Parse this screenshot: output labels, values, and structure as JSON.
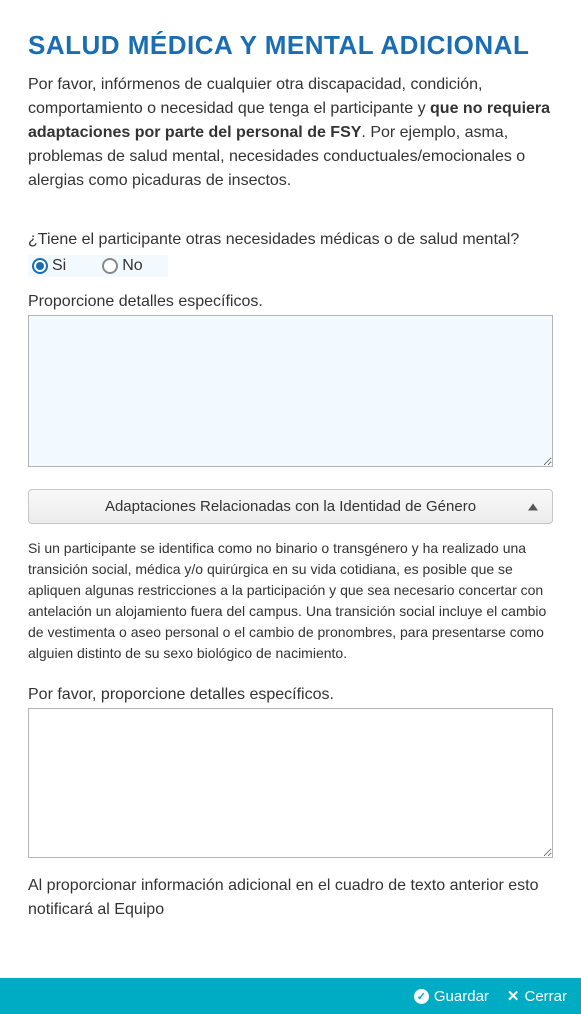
{
  "header": {
    "title": "SALUD MÉDICA Y MENTAL ADICIONAL"
  },
  "intro": {
    "part1": "Por favor, infórmenos de cualquier otra discapacidad, condición, comportamiento o necesidad que tenga el participante y ",
    "bold": "que no requiera adaptaciones por parte del personal de FSY",
    "part2": ". Por ejemplo, asma, problemas de salud mental, necesidades conductuales/emocionales o alergias como picaduras de insectos."
  },
  "question1": {
    "label": "¿Tiene el participante otras necesidades médicas o de salud mental?",
    "option_yes": "Si",
    "option_no": "No",
    "selected": "yes"
  },
  "details1": {
    "label": "Proporcione detalles específicos.",
    "value": ""
  },
  "accordion": {
    "title": "Adaptaciones Relacionadas con la Identidad de Género",
    "body": "Si un participante se identifica como no binario o transgénero y ha realizado una transición social, médica y/o quirúrgica en su vida cotidiana, es posible que se apliquen algunas restricciones a la participación y que sea necesario concertar con antelación un alojamiento fuera del campus. Una transición social incluye el cambio de vestimenta o aseo personal o el cambio de pronombres, para presentarse como alguien distinto de su sexo biológico de nacimiento."
  },
  "details2": {
    "label": "Por favor, proporcione detalles específicos.",
    "value": ""
  },
  "footer_note": "Al proporcionar información adicional en el cuadro de texto anterior esto notificará al Equipo",
  "actions": {
    "save": "Guardar",
    "close": "Cerrar"
  }
}
